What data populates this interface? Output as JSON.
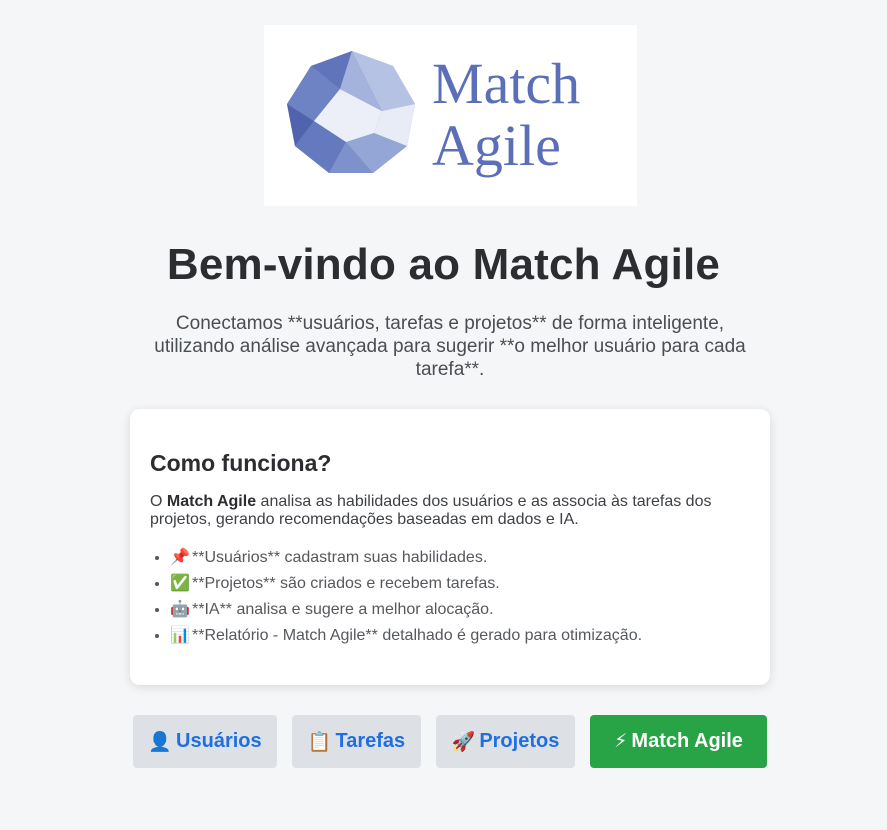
{
  "logo": {
    "line1": "Match",
    "line2": "Agile",
    "text_color": "#5b6eb8",
    "mark_color": "#6f85c6"
  },
  "hero": {
    "title": "Bem-vindo ao Match Agile",
    "intro": "Conectamos **usuários, tarefas e projetos** de forma inteligente, utilizando análise avançada para sugerir **o melhor usuário para cada tarefa**."
  },
  "how_it_works": {
    "title": "Como funciona?",
    "desc_prefix": "O ",
    "desc_bold": "Match Agile",
    "desc_rest": " analisa as habilidades dos usuários e as associa às tarefas dos projetos, gerando recomendações baseadas em dados e IA.",
    "items": [
      {
        "icon": "📌",
        "icon_name": "pushpin-icon",
        "text": "**Usuários** cadastram suas habilidades."
      },
      {
        "icon": "✅",
        "icon_name": "check-mark-icon",
        "text": "**Projetos** são criados e recebem tarefas."
      },
      {
        "icon": "🤖",
        "icon_name": "robot-icon",
        "text": "**IA** analisa e sugere a melhor alocação."
      },
      {
        "icon": "📊",
        "icon_name": "bar-chart-icon",
        "text": "**Relatório - Match Agile** detalhado é gerado para otimização."
      }
    ]
  },
  "buttons": {
    "users": {
      "icon": "👤",
      "label": "Usuários"
    },
    "tasks": {
      "icon": "📋",
      "label": "Tarefas"
    },
    "projects": {
      "icon": "🚀",
      "label": "Projetos"
    },
    "match": {
      "icon": "⚡",
      "label": "Match Agile"
    }
  },
  "colors": {
    "background": "#f5f6f8",
    "link_blue": "#1f6fe0",
    "secondary_button": "#dde1e6",
    "primary_button": "#28a345"
  }
}
